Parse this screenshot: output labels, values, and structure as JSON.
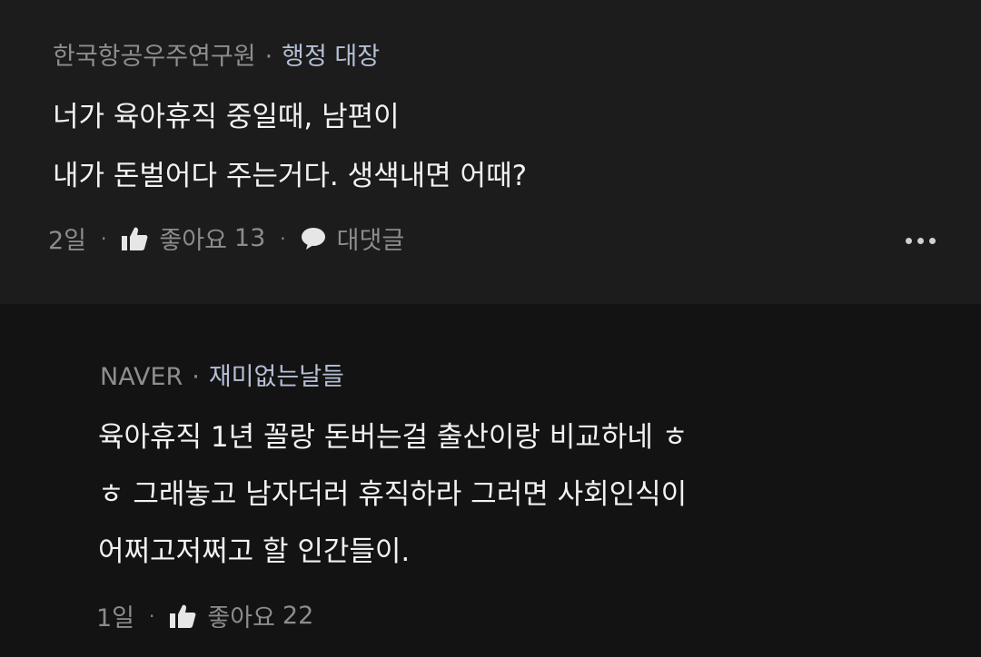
{
  "comments": [
    {
      "company": "한국항공우주연구원",
      "separator": "·",
      "role": "행정 대장",
      "lines": [
        "너가 육아휴직 중일때, 남편이",
        "내가 돈벌어다 주는거다. 생색내면 어때?"
      ],
      "time": "2일",
      "like_label": "좋아요",
      "like_count": "13",
      "reply_label": "대댓글"
    },
    {
      "company": "NAVER",
      "separator": "·",
      "role": "재미없는날들",
      "lines": [
        "육아휴직 1년 꼴랑 돈버는걸 출산이랑 비교하네 ㅎ",
        "ㅎ 그래놓고 남자더러 휴직하라 그러면 사회인식이",
        "어쩌고저쩌고 할 인간들이."
      ],
      "time": "1일",
      "like_label": "좋아요",
      "like_count": "22"
    }
  ],
  "meta_separator": "·",
  "icons": {
    "like": "thumbs-up-icon",
    "reply": "speech-bubble-icon",
    "more": "more-horizontal-icon"
  },
  "colors": {
    "background_top": "#1c1c1c",
    "background_bottom": "#131313",
    "body_text": "#f2f2f2",
    "meta_text": "#8c8c8c",
    "role_text": "#b5bfd6"
  }
}
